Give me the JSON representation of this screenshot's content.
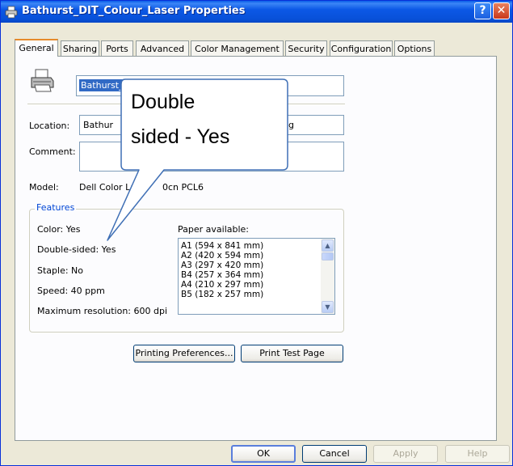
{
  "window": {
    "title": "Bathurst_DIT_Colour_Laser Properties",
    "help_glyph": "?",
    "close_glyph": "✕"
  },
  "tabs": [
    {
      "label": "General",
      "active": true
    },
    {
      "label": "Sharing"
    },
    {
      "label": "Ports"
    },
    {
      "label": "Advanced"
    },
    {
      "label": "Color Management"
    },
    {
      "label": "Security"
    },
    {
      "label": "Configuration"
    },
    {
      "label": "Options"
    }
  ],
  "general": {
    "printer_name_value": "Bathurst_",
    "location_label": "Location:",
    "location_value": "Bathur",
    "location_value_tail": "g",
    "comment_label": "Comment:",
    "comment_value": "",
    "model_label": "Model:",
    "model_value_start": "Dell Color La",
    "model_value_end": "0cn PCL6"
  },
  "features": {
    "title": "Features",
    "color": "Color: Yes",
    "double_sided": "Double-sided: Yes",
    "staple": "Staple: No",
    "speed": "Speed: 40 ppm",
    "max_resolution": "Maximum resolution: 600 dpi",
    "paper_label": "Paper available:",
    "paper": [
      "A1 (594 x 841 mm)",
      "A2 (420 x 594 mm)",
      "A3 (297 x 420 mm)",
      "B4 (257 x 364 mm)",
      "A4 (210 x 297 mm)",
      "B5 (182 x 257 mm)"
    ]
  },
  "buttons": {
    "printing_preferences": "Printing Preferences...",
    "print_test_page": "Print Test Page",
    "ok": "OK",
    "cancel": "Cancel",
    "apply": "Apply",
    "help": "Help"
  },
  "callout": {
    "line1": "Double",
    "line2": "sided - Yes"
  },
  "colors": {
    "titlebar": "#0a5ce8",
    "dialog_bg": "#ece9d8",
    "active_tab_accent": "#e68b2c",
    "group_title": "#0046d5",
    "selection": "#316ac5"
  }
}
